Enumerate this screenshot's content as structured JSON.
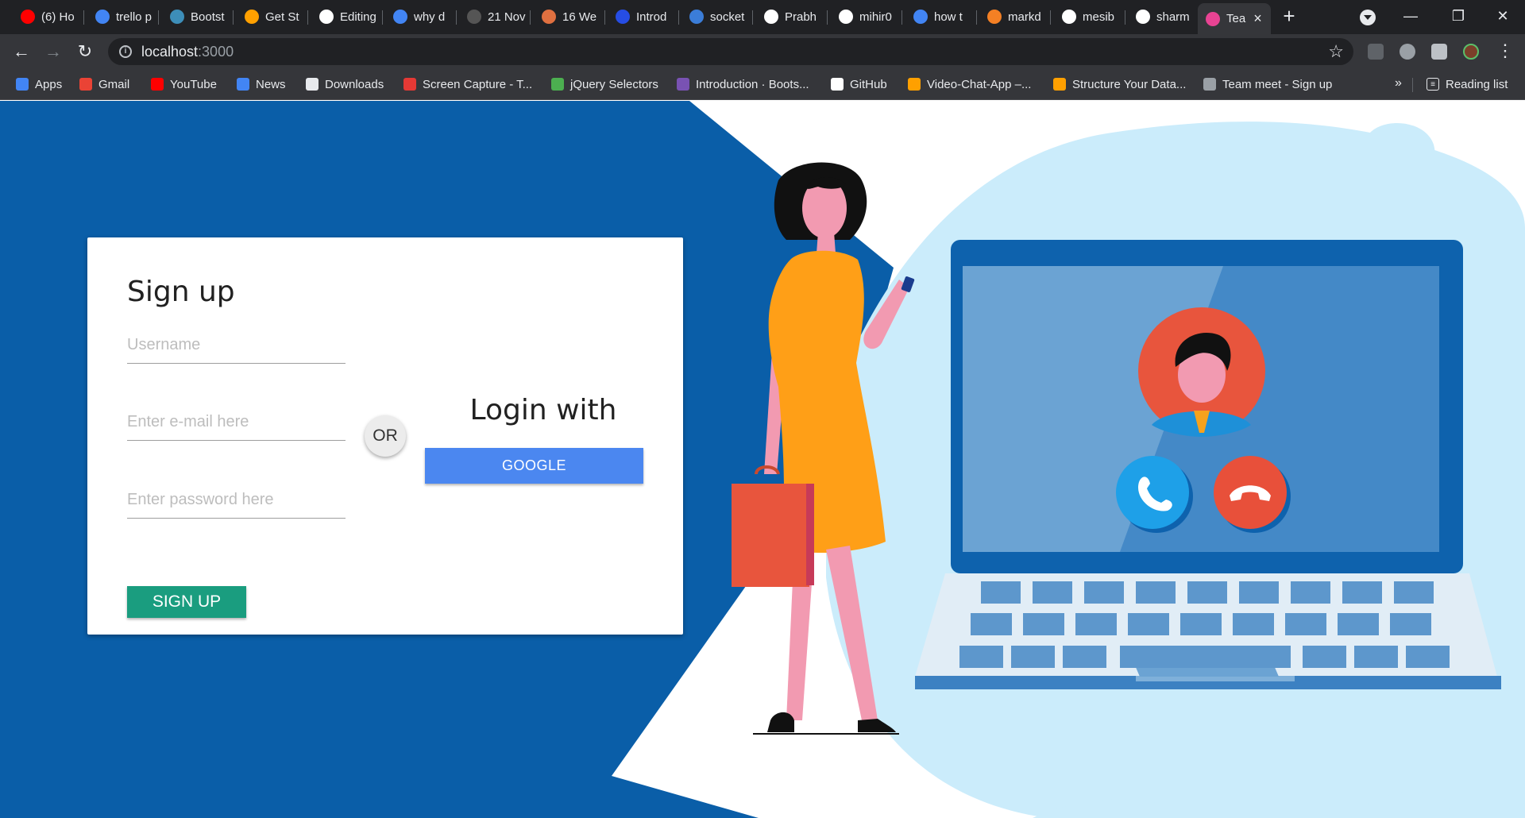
{
  "browser": {
    "tabs": [
      {
        "label": "(6) Ho",
        "icon": "youtube-icon",
        "color": "#ff0000"
      },
      {
        "label": "trello p",
        "icon": "google-icon",
        "color": "#4285f4"
      },
      {
        "label": "Bootst",
        "icon": "bootsnipp-icon",
        "color": "#3d8eb9"
      },
      {
        "label": "Get St",
        "icon": "firebase-icon",
        "color": "#ffa000"
      },
      {
        "label": "Editing",
        "icon": "github-icon",
        "color": "#ffffff"
      },
      {
        "label": "why d",
        "icon": "google-icon",
        "color": "#4285f4"
      },
      {
        "label": "21 Nov",
        "icon": "dev-icon",
        "color": "#555555"
      },
      {
        "label": "16 We",
        "icon": "cup-icon",
        "color": "#e07040"
      },
      {
        "label": "Introd",
        "icon": "css3-icon",
        "color": "#264de4"
      },
      {
        "label": "socket",
        "icon": "layers-icon",
        "color": "#3b7dd8"
      },
      {
        "label": "Prabh",
        "icon": "github-icon",
        "color": "#ffffff"
      },
      {
        "label": "mihir0",
        "icon": "github-icon",
        "color": "#ffffff"
      },
      {
        "label": "how t",
        "icon": "google-icon",
        "color": "#4285f4"
      },
      {
        "label": "markd",
        "icon": "stackoverflow-icon",
        "color": "#f48024"
      },
      {
        "label": "mesib",
        "icon": "github-icon",
        "color": "#ffffff"
      },
      {
        "label": "sharm",
        "icon": "github-icon",
        "color": "#ffffff"
      },
      {
        "label": "Tea",
        "icon": "team-meet-icon",
        "color": "#e84393",
        "active": true
      }
    ],
    "url_host": "localhost",
    "url_port": ":3000",
    "bookmarks": [
      {
        "label": "Apps",
        "icon": "apps-grid-icon",
        "color": "#4285f4"
      },
      {
        "label": "Gmail",
        "icon": "gmail-icon",
        "color": "#ea4335"
      },
      {
        "label": "YouTube",
        "icon": "youtube-icon",
        "color": "#ff0000"
      },
      {
        "label": "News",
        "icon": "google-news-icon",
        "color": "#4285f4"
      },
      {
        "label": "Downloads",
        "icon": "download-icon",
        "color": "#e8eaed"
      },
      {
        "label": "Screen Capture - T...",
        "icon": "screen-capture-icon",
        "color": "#e53935"
      },
      {
        "label": "jQuery Selectors",
        "icon": "w3schools-icon",
        "color": "#4caf50"
      },
      {
        "label": "Introduction · Boots...",
        "icon": "bootstrap-icon",
        "color": "#7952b3"
      },
      {
        "label": "GitHub",
        "icon": "github-icon",
        "color": "#ffffff"
      },
      {
        "label": "Video-Chat-App –...",
        "icon": "firebase-icon",
        "color": "#ffa000"
      },
      {
        "label": "Structure Your Data...",
        "icon": "firebase-icon",
        "color": "#ffa000"
      },
      {
        "label": "Team meet - Sign up",
        "icon": "globe-icon",
        "color": "#9aa0a6"
      }
    ],
    "reading_list": "Reading list",
    "more": "»"
  },
  "signup": {
    "title": "Sign up",
    "username_placeholder": "Username",
    "email_placeholder": "Enter e-mail here",
    "password_placeholder": "Enter password here",
    "submit_label": "SIGN UP",
    "or_label": "OR",
    "login_title": "Login with",
    "google_label": "GOOGLE"
  },
  "colors": {
    "page_blue": "#0a5ea8",
    "light_blue": "#cbecfb",
    "signup_green": "#1a9d7f",
    "google_blue": "#4b87f0",
    "accept_call": "#1ea0e8",
    "decline_call": "#e8503a"
  }
}
